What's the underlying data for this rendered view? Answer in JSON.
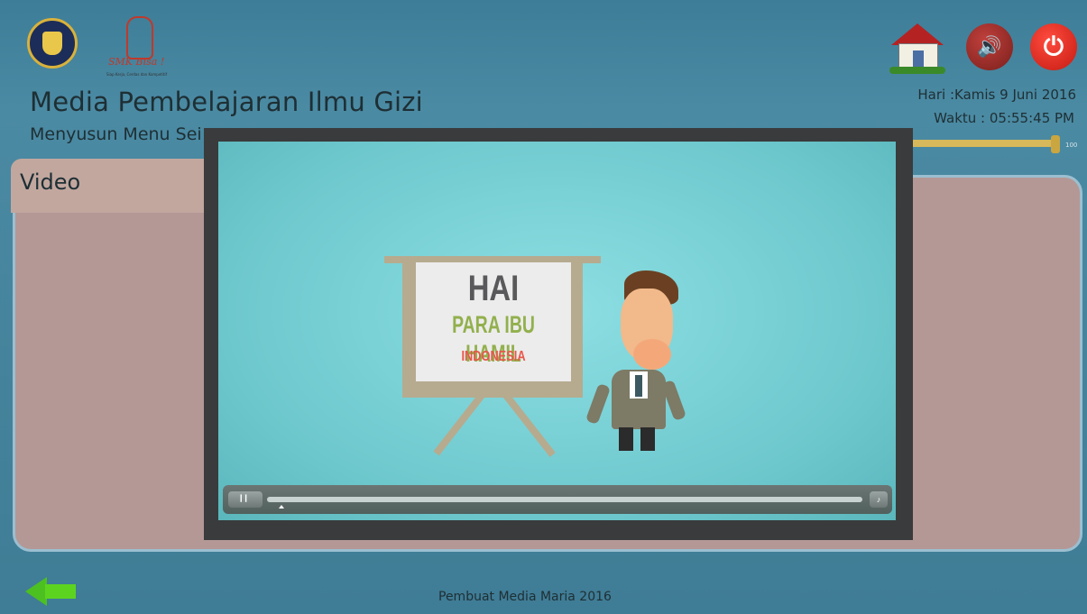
{
  "header": {
    "title": "Media Pembelajaran Ilmu Gizi",
    "subtitle": "Menyusun Menu Sei",
    "logo_brand": "SMK Bisa !",
    "logo_tagline": "Siap Kerja, Cerdas dan Kompetitif",
    "day_text": "Hari :Kamis 9 Juni 2016",
    "time_text": "Waktu : 05:55:45 PM",
    "volume_value": "100",
    "icons": [
      "home-icon",
      "sound-icon",
      "power-icon"
    ]
  },
  "section": {
    "label": "Video"
  },
  "video": {
    "line1": "HAI",
    "line2": "PARA IBU HAMIL",
    "line3": "INDONESIA",
    "play_label": "▎▎",
    "volume_icon": "♪",
    "progress": 0.02
  },
  "footer": {
    "text": "Pembuat Media Maria 2016"
  },
  "colors": {
    "background": "#3f7c95",
    "panel": "#b49896",
    "video_bg": "#6cc7cc",
    "back_arrow": "#4cc021",
    "power": "#e8281b"
  }
}
